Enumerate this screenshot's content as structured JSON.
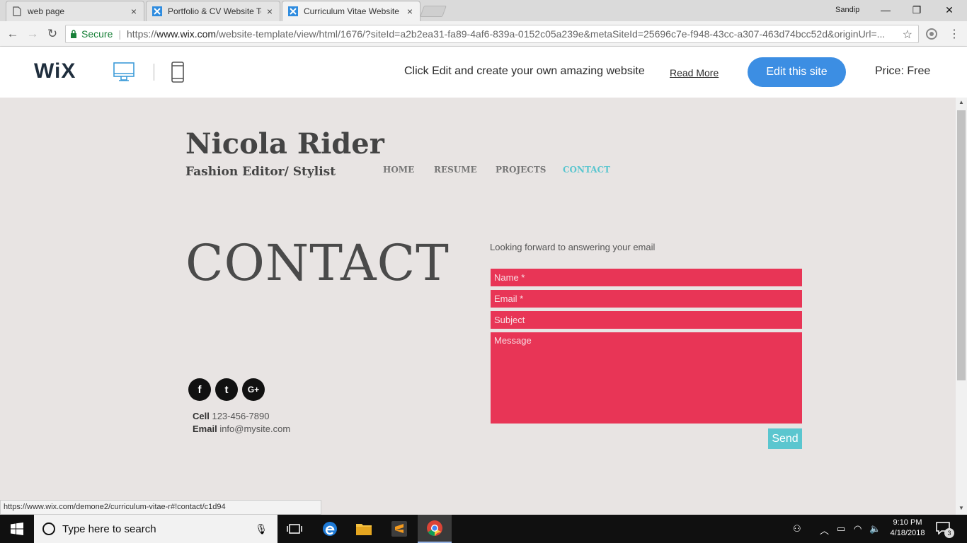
{
  "browser": {
    "tabs": [
      {
        "title": "web page",
        "close": "×"
      },
      {
        "title": "Portfolio & CV Website Te",
        "close": "×"
      },
      {
        "title": "Curriculum Vitae Website",
        "close": "×"
      }
    ],
    "user": "Sandip",
    "window_controls": {
      "minimize": "—",
      "restore": "❐",
      "close": "✕"
    },
    "secure_label": "Secure",
    "url_scheme": "https://",
    "url_host": "www.wix.com",
    "url_path": "/website-template/view/html/1676/?siteId=a2b2ea31-fa89-4af6-839a-0152c05a239e&metaSiteId=25696c7e-f948-43cc-a307-463d74bcc52d&originUrl=...",
    "status_url": "https://www.wix.com/demone2/curriculum-vitae-r#!contact/c1d94"
  },
  "wixbar": {
    "logo": "WiX",
    "message": "Click Edit and create your own amazing website",
    "read_more": "Read More",
    "edit_button": "Edit this site",
    "price": "Price: Free"
  },
  "site": {
    "name": "Nicola Rider",
    "role": "Fashion Editor/ Stylist",
    "nav": [
      "HOME",
      "RESUME",
      "PROJECTS",
      "CONTACT"
    ],
    "active_nav": "CONTACT",
    "heading": "CONTACT",
    "lead": "Looking forward to answering your email",
    "form": {
      "name_placeholder": "Name *",
      "email_placeholder": "Email *",
      "subject_placeholder": "Subject",
      "message_placeholder": "Message",
      "send": "Send"
    },
    "social": [
      "f",
      "t",
      "G+"
    ],
    "contact": {
      "cell_label": "Cell",
      "cell": "123-456-7890",
      "email_label": "Email",
      "email": "info@mysite.com"
    },
    "colors": {
      "accent": "#5bc6cf",
      "form_fill": "#e83556",
      "background": "#e8e4e3"
    }
  },
  "taskbar": {
    "search_placeholder": "Type here to search",
    "time": "9:10 PM",
    "date": "4/18/2018",
    "notification_count": "3"
  }
}
